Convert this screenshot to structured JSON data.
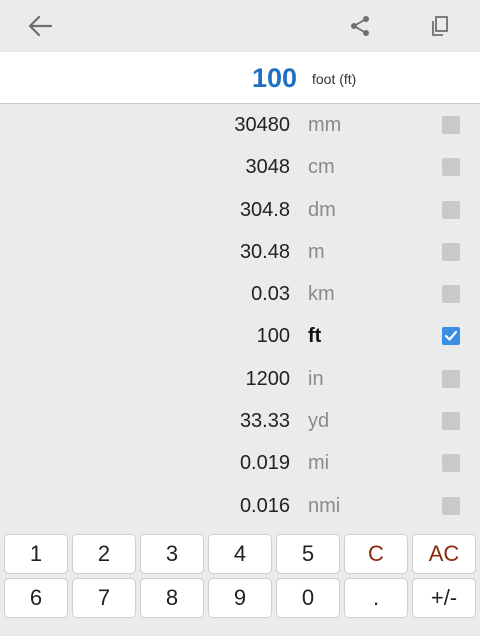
{
  "toolbar": {
    "back_icon": "arrow-left-icon",
    "share_icon": "share-icon",
    "copy_icon": "copy-icon"
  },
  "input": {
    "value": "100",
    "unit": "foot (ft)"
  },
  "conversions": [
    {
      "value": "30480",
      "unit": "mm",
      "checked": false
    },
    {
      "value": "3048",
      "unit": "cm",
      "checked": false
    },
    {
      "value": "304.8",
      "unit": "dm",
      "checked": false
    },
    {
      "value": "30.48",
      "unit": "m",
      "checked": false
    },
    {
      "value": "0.03",
      "unit": "km",
      "checked": false
    },
    {
      "value": "100",
      "unit": "ft",
      "checked": true
    },
    {
      "value": "1200",
      "unit": "in",
      "checked": false
    },
    {
      "value": "33.33",
      "unit": "yd",
      "checked": false
    },
    {
      "value": "0.019",
      "unit": "mi",
      "checked": false
    },
    {
      "value": "0.016",
      "unit": "nmi",
      "checked": false
    }
  ],
  "keypad": {
    "row1": [
      "1",
      "2",
      "3",
      "4",
      "5",
      "C",
      "AC"
    ],
    "row2": [
      "6",
      "7",
      "8",
      "9",
      "0",
      ".",
      "+/-"
    ]
  },
  "colors": {
    "accent": "#1f6fc3",
    "checkbox_on": "#3a8ee6",
    "clear_keys": "#8b2a0e"
  }
}
